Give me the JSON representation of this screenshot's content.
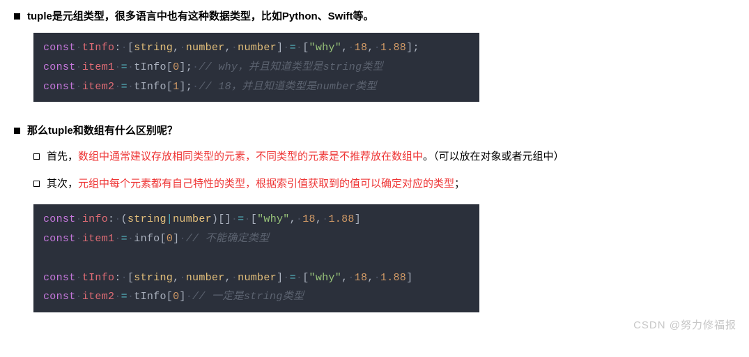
{
  "section1": {
    "heading": "tuple是元组类型，很多语言中也有这种数据类型，比如Python、Swift等。"
  },
  "code1": {
    "l1": {
      "kw": "const",
      "sp1": " ",
      "var": "tInfo",
      "colon": ":",
      "sp2": " ",
      "lb": "[",
      "t1": "string",
      "c1": ",",
      "sp3": " ",
      "t2": "number",
      "c2": ",",
      "sp4": " ",
      "t3": "number",
      "rb": "]",
      "sp5": " ",
      "eq": "=",
      "sp6": " ",
      "lb2": "[",
      "s1": "\"why\"",
      "c3": ",",
      "sp7": " ",
      "n1": "18",
      "c4": ",",
      "sp8": " ",
      "n2": "1.88",
      "rb2": "]",
      "semi": ";"
    },
    "l2": {
      "kw": "const",
      "sp1": " ",
      "var": "item1",
      "sp2": " ",
      "eq": "=",
      "sp3": " ",
      "obj": "tInfo",
      "lb": "[",
      "idx": "0",
      "rb": "]",
      "semi": ";",
      "sp4": " ",
      "comment": "// why，并且知道类型是string类型"
    },
    "l3": {
      "kw": "const",
      "sp1": " ",
      "var": "item2",
      "sp2": " ",
      "eq": "=",
      "sp3": " ",
      "obj": "tInfo",
      "lb": "[",
      "idx": "1",
      "rb": "]",
      "semi": ";",
      "sp4": " ",
      "comment": "// 18，并且知道类型是number类型"
    }
  },
  "section2": {
    "heading": "那么tuple和数组有什么区别呢？",
    "item1": {
      "prefix": "首先，",
      "red1": "数组中通常建议存放相同类型的元素，",
      "red2": "不同类型的元素是不推荐放在数组中",
      "tail": "。（可以放在对象或者元组中）"
    },
    "item2": {
      "prefix": "其次，",
      "red1": "元组中每个元素都有自己特性的类型，",
      "red2": "根据索引值获取到的值可以确定对应的类型",
      "tail": "；"
    }
  },
  "code2": {
    "l1": {
      "kw": "const",
      "sp1": " ",
      "var": "info",
      "colon": ":",
      "sp2": " ",
      "lp": "(",
      "t1": "string",
      "pipe": "|",
      "t2": "number",
      "rp": ")",
      "arr": "[]",
      "sp3": " ",
      "eq": "=",
      "sp4": " ",
      "lb": "[",
      "s1": "\"why\"",
      "c1": ",",
      "sp5": " ",
      "n1": "18",
      "c2": ",",
      "sp6": " ",
      "n2": "1.88",
      "rb": "]"
    },
    "l2": {
      "kw": "const",
      "sp1": " ",
      "var": "item1",
      "sp2": " ",
      "eq": "=",
      "sp3": " ",
      "obj": "info",
      "lb": "[",
      "idx": "0",
      "rb": "]",
      "sp4": " ",
      "comment": "// 不能确定类型"
    },
    "l3": "",
    "l4": {
      "kw": "const",
      "sp1": " ",
      "var": "tInfo",
      "colon": ":",
      "sp2": " ",
      "lb": "[",
      "t1": "string",
      "c1": ",",
      "sp3": " ",
      "t2": "number",
      "c2": ",",
      "sp4": " ",
      "t3": "number",
      "rb": "]",
      "sp5": " ",
      "eq": "=",
      "sp6": " ",
      "lb2": "[",
      "s1": "\"why\"",
      "c3": ",",
      "sp7": " ",
      "n1": "18",
      "c4": ",",
      "sp8": " ",
      "n2": "1.88",
      "rb2": "]"
    },
    "l5": {
      "kw": "const",
      "sp1": " ",
      "var": "item2",
      "sp2": " ",
      "eq": "=",
      "sp3": " ",
      "obj": "tInfo",
      "lb": "[",
      "idx": "0",
      "rb": "]",
      "sp4": " ",
      "comment": "// 一定是string类型"
    }
  },
  "watermark": "CSDN @努力修福报"
}
